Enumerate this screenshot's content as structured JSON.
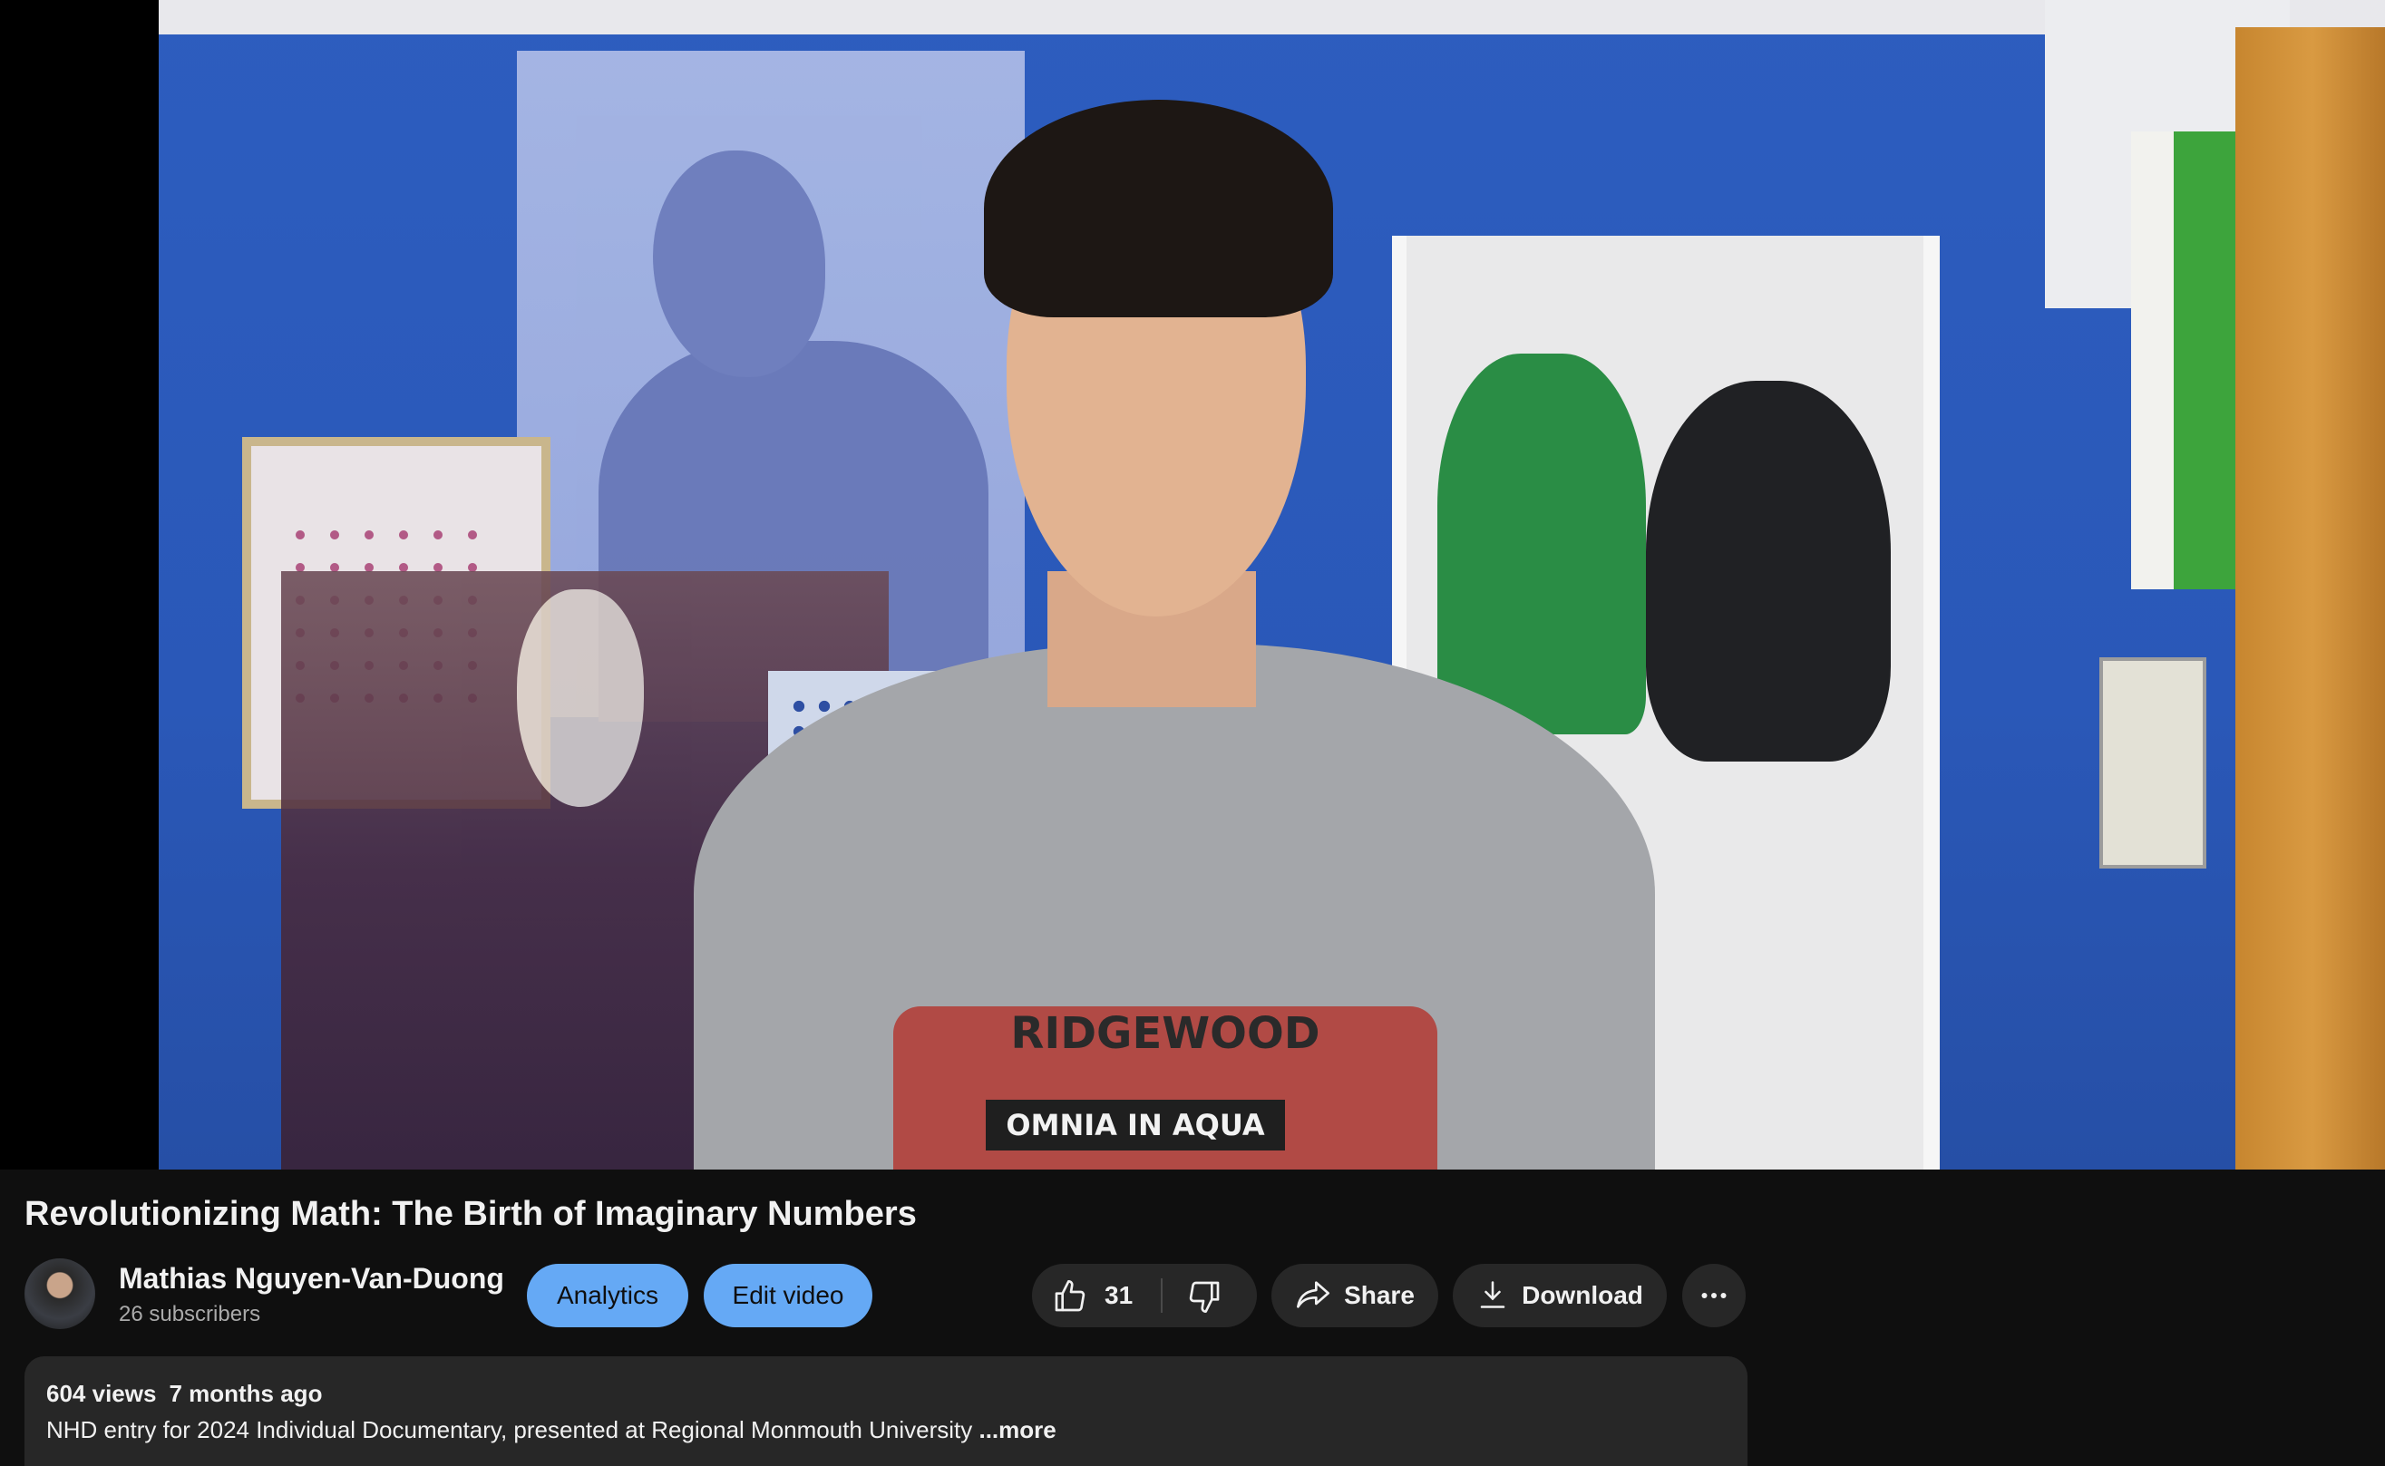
{
  "video": {
    "title": "Revolutionizing Math: The Birth of Imaginary Numbers",
    "shirt_text": "RIDGEWOOD",
    "shirt_band": "OMNIA IN AQUA"
  },
  "channel": {
    "name": "Mathias Nguyen-Van-Duong",
    "subscribers": "26 subscribers"
  },
  "actions": {
    "analytics_label": "Analytics",
    "edit_label": "Edit video",
    "like_count": "31",
    "share_label": "Share",
    "download_label": "Download",
    "accent_color": "#65a9f5"
  },
  "description": {
    "views": "604 views",
    "age": "7 months ago",
    "text": "NHD entry for 2024 Individual Documentary, presented at Regional Monmouth University",
    "more_label": "...more"
  },
  "icons": {
    "like": "thumbs-up-icon",
    "dislike": "thumbs-down-icon",
    "share": "share-arrow-icon",
    "download": "download-icon",
    "more": "more-horizontal-icon"
  }
}
